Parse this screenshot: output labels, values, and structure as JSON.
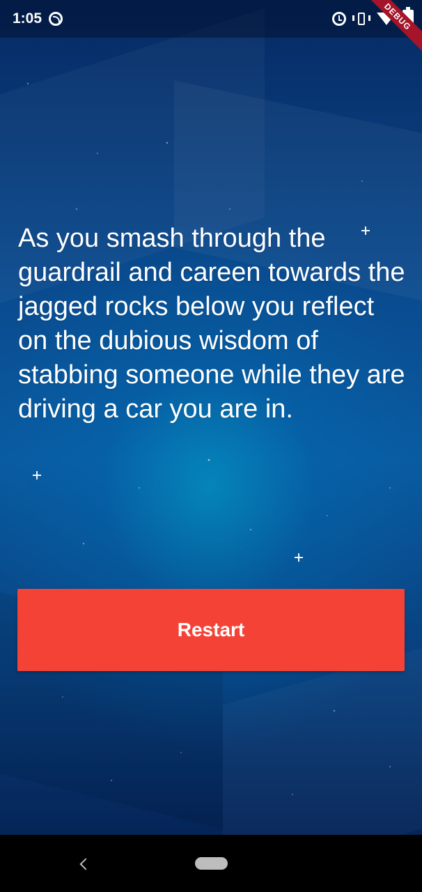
{
  "status_bar": {
    "time": "1:05",
    "icons": [
      "sync-icon",
      "alarm-icon",
      "vibrate-icon",
      "wifi-icon",
      "battery-charging-icon"
    ]
  },
  "debug_banner": {
    "label": "DEBUG",
    "color": "#a4152a"
  },
  "story": {
    "text": "As you smash through the guardrail and careen towards the jagged rocks below you reflect on the dubious wisdom of stabbing someone while they are driving a car you are in."
  },
  "restart_button": {
    "label": "Restart",
    "color": "#f44336"
  },
  "nav_bar": {
    "icons": [
      "back-icon",
      "home-pill-icon"
    ]
  },
  "colors": {
    "background_top": "#062a63",
    "background_mid": "#0a5aa0",
    "text": "#ffffff"
  }
}
